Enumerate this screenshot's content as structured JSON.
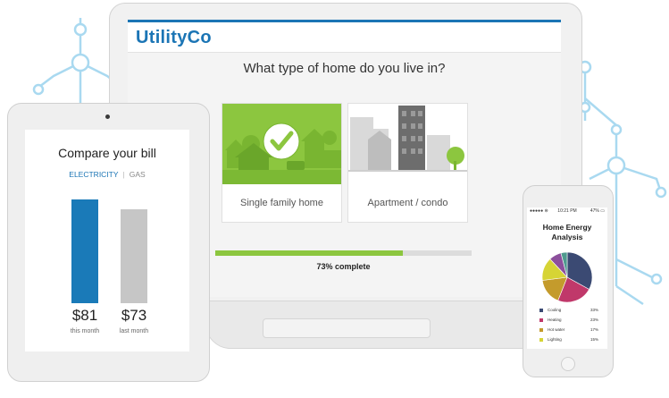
{
  "colors": {
    "brand": "#1b75b5",
    "accent_green": "#8cc63f",
    "circuit": "#a9d9f0"
  },
  "laptop": {
    "brand": "UtilityCo",
    "question": "What type of home do you live in?",
    "options": [
      {
        "label": "Single family home",
        "selected": true,
        "icon": "check-icon"
      },
      {
        "label": "Apartment / condo",
        "selected": false
      }
    ],
    "progress": {
      "percent": 73,
      "text": "73% complete"
    }
  },
  "tablet": {
    "title": "Compare your bill",
    "tabs": [
      {
        "label": "ELECTRICITY",
        "active": true
      },
      {
        "label": "GAS",
        "active": false
      }
    ],
    "separator": "|",
    "bars": [
      {
        "amount": "$81",
        "caption": "this month",
        "value": 81,
        "color": "#1a7ab8"
      },
      {
        "amount": "$73",
        "caption": "last month",
        "value": 73,
        "color": "#c6c6c6"
      }
    ]
  },
  "phone": {
    "status": {
      "left": "●●●●● ⊜",
      "time": "10:21 PM",
      "right": "47% ▭"
    },
    "title": "Home Energy Analysis",
    "chart_data": {
      "type": "pie",
      "title": "Home Energy Analysis",
      "series": [
        {
          "name": "Cooling",
          "value": 33,
          "label": "33%",
          "color": "#3b4a73"
        },
        {
          "name": "Heating",
          "value": 23,
          "label": "23%",
          "color": "#c0386a"
        },
        {
          "name": "Hot water",
          "value": 17,
          "label": "17%",
          "color": "#c49b2c"
        },
        {
          "name": "Lighting",
          "value": 15,
          "label": "15%",
          "color": "#d6d435"
        },
        {
          "name": "",
          "value": 8,
          "color": "#8c4f9c"
        },
        {
          "name": "",
          "value": 4,
          "color": "#4f9a8f"
        }
      ]
    }
  }
}
